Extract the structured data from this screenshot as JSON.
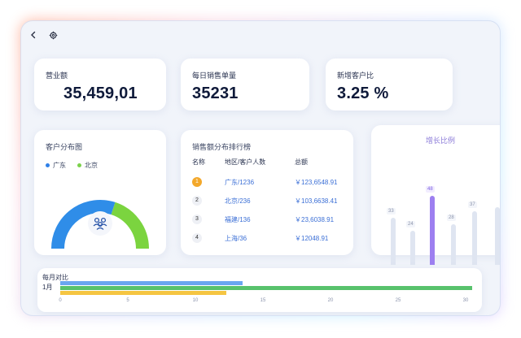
{
  "nav": {
    "back_icon": "chevron-left-icon",
    "settings_icon": "gear-icon"
  },
  "kpis": [
    {
      "label": "营业额",
      "value": "35,459,01"
    },
    {
      "label": "每日销售单量",
      "value": "35231"
    },
    {
      "label": "新增客户比",
      "value": "3.25 %"
    }
  ],
  "distribution": {
    "title": "客户分布图",
    "legend": [
      {
        "name": "广东",
        "color": "#2f80e8"
      },
      {
        "name": "北京",
        "color": "#7bd14b"
      }
    ],
    "gauge": {
      "values": [
        0.6,
        0.4
      ],
      "colors": [
        "#2f8de8",
        "#7bd43f"
      ],
      "icon": "users-icon"
    }
  },
  "ranking": {
    "title": "销售额分布排行榜",
    "headers": [
      "名称",
      "地区/客户人数",
      "总额"
    ],
    "rows": [
      {
        "rank": "1",
        "region": "广东/1236",
        "total": "￥123,6548.91"
      },
      {
        "rank": "2",
        "region": "北京/236",
        "total": "￥103,6638.41"
      },
      {
        "rank": "3",
        "region": "福建/136",
        "total": "￥23,6038.91"
      },
      {
        "rank": "4",
        "region": "上海/36",
        "total": "￥12048.91"
      }
    ]
  },
  "growth": {
    "title": "增长比例",
    "bars": [
      {
        "label": "33",
        "value": 33,
        "active": false
      },
      {
        "label": "24",
        "value": 24,
        "active": false
      },
      {
        "label": "48",
        "value": 48,
        "active": true
      },
      {
        "label": "28",
        "value": 28,
        "active": false
      },
      {
        "label": "37",
        "value": 37,
        "active": false
      },
      {
        "label": "",
        "value": 40,
        "active": false
      }
    ]
  },
  "monthly": {
    "title": "每月对比",
    "category": "1月",
    "ticks": [
      "0",
      "5",
      "10",
      "15",
      "20",
      "25",
      "30"
    ],
    "axis_max": 30,
    "series": [
      {
        "value": 13.5,
        "color": "#6aa6f0"
      },
      {
        "value": 30.5,
        "color": "#58c26c"
      },
      {
        "value": 12.3,
        "color": "#f5c542"
      }
    ]
  }
}
